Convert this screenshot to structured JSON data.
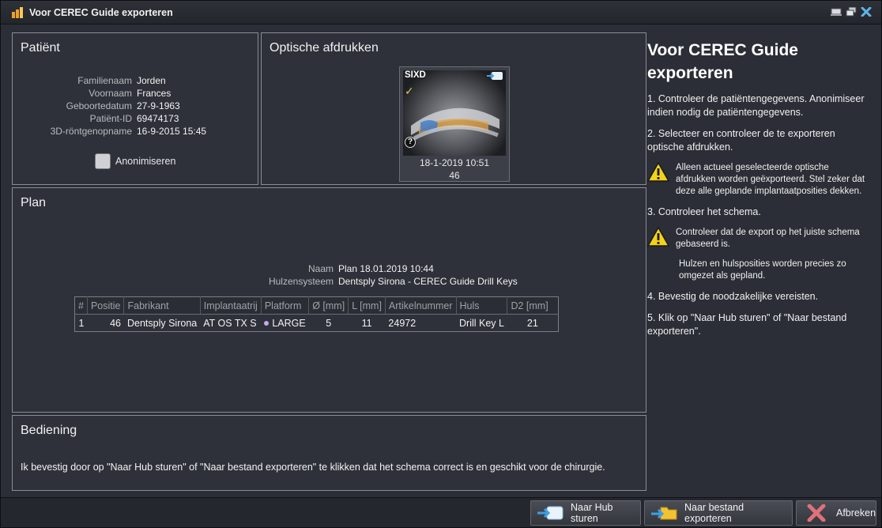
{
  "window": {
    "title": "Voor CEREC Guide exporteren"
  },
  "patient": {
    "title": "Patiënt",
    "fields": [
      {
        "label": "Familienaam",
        "value": "Jorden"
      },
      {
        "label": "Voornaam",
        "value": "Frances"
      },
      {
        "label": "Geboortedatum",
        "value": "27-9-1963"
      },
      {
        "label": "Patiënt-ID",
        "value": "69474173"
      },
      {
        "label": "3D-röntgenopname",
        "value": "16-9-2015 15:45"
      }
    ],
    "anonymize_label": "Anonimiseren",
    "anonymize_checked": false
  },
  "optical": {
    "title": "Optische afdrukken",
    "impression": {
      "badge": "SIXD",
      "date": "18-1-2019 10:51",
      "count": "46",
      "selected": true
    }
  },
  "plan": {
    "title": "Plan",
    "name_label": "Naam",
    "name_value": "Plan 18.01.2019 10:44",
    "system_label": "Hulzensysteem",
    "system_value": "Dentsply Sirona - CEREC Guide Drill Keys",
    "columns": [
      "#",
      "Positie",
      "Fabrikant",
      "Implantaatrij",
      "Platform",
      "Ø [mm]",
      "L [mm]",
      "Artikelnummer",
      "Huls",
      "D2 [mm]"
    ],
    "rows": [
      {
        "idx": "1",
        "position": "46",
        "manufacturer": "Dentsply Sirona",
        "line": "AT OS TX S",
        "platform": "LARGE",
        "diameter": "5",
        "length": "11",
        "article": "24972",
        "sleeve": "Drill Key L",
        "d2": "21"
      }
    ],
    "platform_color": "#c7a8ea"
  },
  "operation": {
    "title": "Bediening",
    "text": "Ik bevestig door op \"Naar Hub sturen\" of \"Naar bestand exporteren\" te klikken dat het schema correct is en geschikt voor de chirurgie."
  },
  "help": {
    "title": "Voor CEREC Guide exporteren",
    "step1": "1. Controleer de patiëntengegevens. Anonimiseer indien nodig de patiëntengegevens.",
    "step2": "2. Selecteer en controleer de te exporteren optische afdrukken.",
    "warning1": "Alleen actueel geselecteerde optische afdrukken worden geëxporteerd. Stel zeker dat deze alle geplande implantaatposities dekken.",
    "step3": "3. Controleer het schema.",
    "warning2": "Controleer dat de export op het juiste schema gebaseerd is.",
    "note": "Hulzen en hulsposities worden precies zo omgezet als gepland.",
    "step4": "4. Bevestig de noodzakelijke vereisten.",
    "step5": "5. Klik op \"Naar Hub sturen\" of \"Naar bestand exporteren\"."
  },
  "buttons": {
    "hub": "Naar Hub sturen",
    "export": "Naar bestand exporteren",
    "cancel": "Afbreken"
  }
}
